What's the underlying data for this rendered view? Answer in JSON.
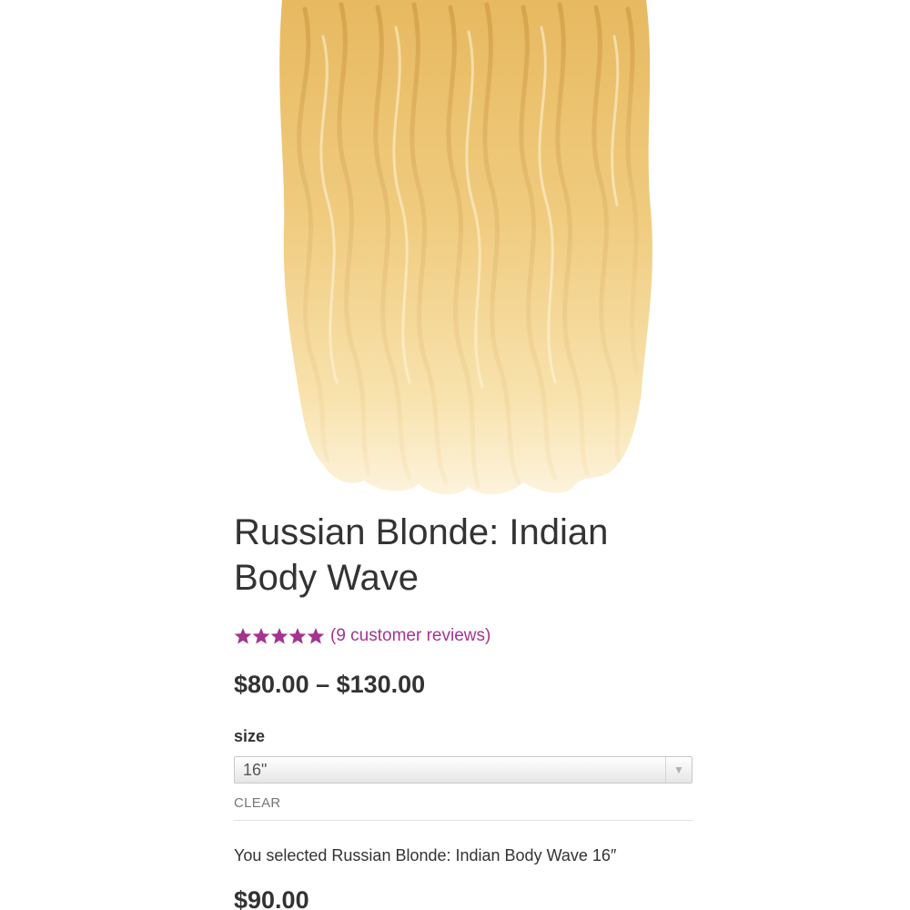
{
  "product": {
    "title_line1": "Russian Blonde: Indian",
    "title_line2": "Body Wave",
    "rating": {
      "stars": 5,
      "star_color": "#a4348f",
      "reviews_text": "(9 customer reviews)"
    },
    "price_range": "$80.00 – $130.00",
    "image_icon": "hair-bundle-image"
  },
  "variation": {
    "label": "size",
    "selected_value": "16\"",
    "clear_label": "CLEAR",
    "selected_text": "You selected Russian Blonde: Indian Body Wave 16″",
    "price": "$90.00"
  }
}
